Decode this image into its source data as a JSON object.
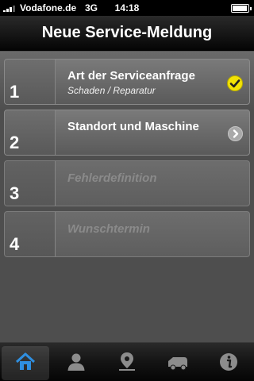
{
  "status_bar": {
    "carrier": "Vodafone.de",
    "network": "3G",
    "time": "14:18"
  },
  "header": {
    "title": "Neue Service-Meldung"
  },
  "steps": [
    {
      "number": "1",
      "title": "Art der Serviceanfrage",
      "subtitle": "Schaden / Reparatur",
      "state": "completed",
      "icon": "checkmark-icon"
    },
    {
      "number": "2",
      "title": "Standort und Maschine",
      "state": "active",
      "icon": "chevron-right-icon"
    },
    {
      "number": "3",
      "title": "Fehlerdefinition",
      "state": "disabled"
    },
    {
      "number": "4",
      "title": "Wunschtermin",
      "state": "disabled"
    }
  ],
  "tab_bar": {
    "tabs": [
      {
        "icon": "home-icon",
        "selected": true
      },
      {
        "icon": "person-icon",
        "selected": false
      },
      {
        "icon": "location-pin-icon",
        "selected": false
      },
      {
        "icon": "machine-icon",
        "selected": false
      },
      {
        "icon": "info-icon",
        "selected": false
      }
    ]
  },
  "colors": {
    "check": "#f2e205",
    "active_tab_icon": "#2f8fe0",
    "inactive_tab_icon": "#8c8c8c"
  }
}
